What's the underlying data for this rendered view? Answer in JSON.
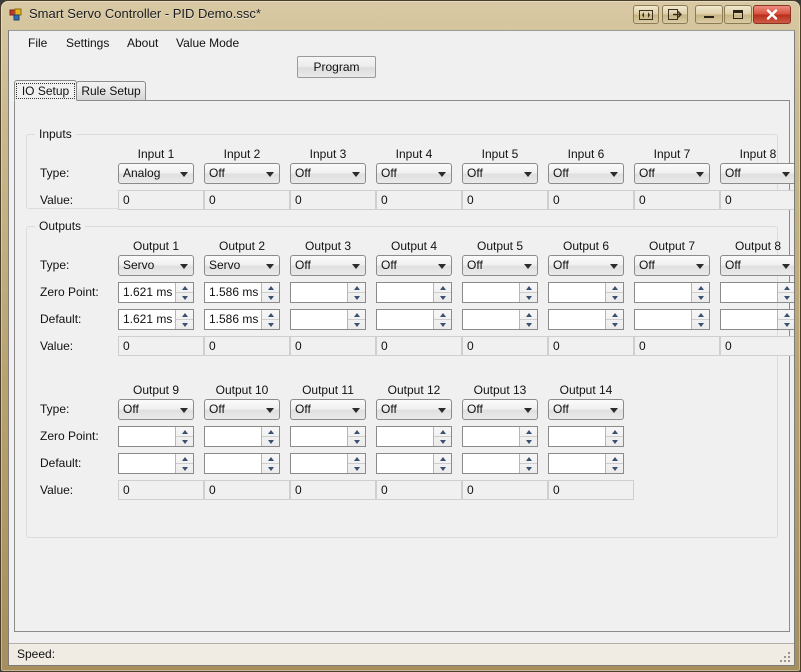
{
  "window": {
    "title": "Smart Servo Controller - PID Demo.ssc*",
    "icon": "app-squares-icon",
    "buttons": {
      "extra1": "toggle-panel-icon",
      "extra2": "detach-panel-icon",
      "minimize": "minimize-icon",
      "maximize": "maximize-icon",
      "close": "close-icon"
    },
    "frame_color": "#c2ab7e",
    "close_color": "#cc3b22"
  },
  "menu": {
    "items": [
      {
        "label": "File"
      },
      {
        "label": "Settings"
      },
      {
        "label": "About"
      },
      {
        "label": "Value Mode"
      }
    ]
  },
  "toolbar": {
    "program_label": "Program"
  },
  "tabs": [
    {
      "label": "IO Setup",
      "active": true
    },
    {
      "label": "Rule Setup",
      "active": false
    }
  ],
  "inputs_group": {
    "label": "Inputs",
    "row_labels": {
      "type": "Type:",
      "value": "Value:"
    },
    "columns": [
      {
        "header": "Input 1",
        "type": "Analog",
        "value": "0"
      },
      {
        "header": "Input 2",
        "type": "Off",
        "value": "0"
      },
      {
        "header": "Input 3",
        "type": "Off",
        "value": "0"
      },
      {
        "header": "Input 4",
        "type": "Off",
        "value": "0"
      },
      {
        "header": "Input 5",
        "type": "Off",
        "value": "0"
      },
      {
        "header": "Input 6",
        "type": "Off",
        "value": "0"
      },
      {
        "header": "Input 7",
        "type": "Off",
        "value": "0"
      },
      {
        "header": "Input 8",
        "type": "Off",
        "value": "0"
      }
    ]
  },
  "outputs_group": {
    "label": "Outputs",
    "row_labels": {
      "type": "Type:",
      "zero_point": "Zero Point:",
      "default": "Default:",
      "value": "Value:"
    },
    "row1": [
      {
        "header": "Output 1",
        "type": "Servo",
        "zero_point": "1.621 ms",
        "default": "1.621 ms",
        "value": "0"
      },
      {
        "header": "Output 2",
        "type": "Servo",
        "zero_point": "1.586 ms",
        "default": "1.586 ms",
        "value": "0"
      },
      {
        "header": "Output 3",
        "type": "Off",
        "zero_point": "",
        "default": "",
        "value": "0"
      },
      {
        "header": "Output 4",
        "type": "Off",
        "zero_point": "",
        "default": "",
        "value": "0"
      },
      {
        "header": "Output 5",
        "type": "Off",
        "zero_point": "",
        "default": "",
        "value": "0"
      },
      {
        "header": "Output 6",
        "type": "Off",
        "zero_point": "",
        "default": "",
        "value": "0"
      },
      {
        "header": "Output 7",
        "type": "Off",
        "zero_point": "",
        "default": "",
        "value": "0"
      },
      {
        "header": "Output 8",
        "type": "Off",
        "zero_point": "",
        "default": "",
        "value": "0"
      }
    ],
    "row2": [
      {
        "header": "Output 9",
        "type": "Off",
        "zero_point": "",
        "default": "",
        "value": "0"
      },
      {
        "header": "Output 10",
        "type": "Off",
        "zero_point": "",
        "default": "",
        "value": "0"
      },
      {
        "header": "Output 11",
        "type": "Off",
        "zero_point": "",
        "default": "",
        "value": "0"
      },
      {
        "header": "Output 12",
        "type": "Off",
        "zero_point": "",
        "default": "",
        "value": "0"
      },
      {
        "header": "Output 13",
        "type": "Off",
        "zero_point": "",
        "default": "",
        "value": "0"
      },
      {
        "header": "Output 14",
        "type": "Off",
        "zero_point": "",
        "default": "",
        "value": "0"
      }
    ]
  },
  "statusbar": {
    "speed_label": "Speed:"
  }
}
